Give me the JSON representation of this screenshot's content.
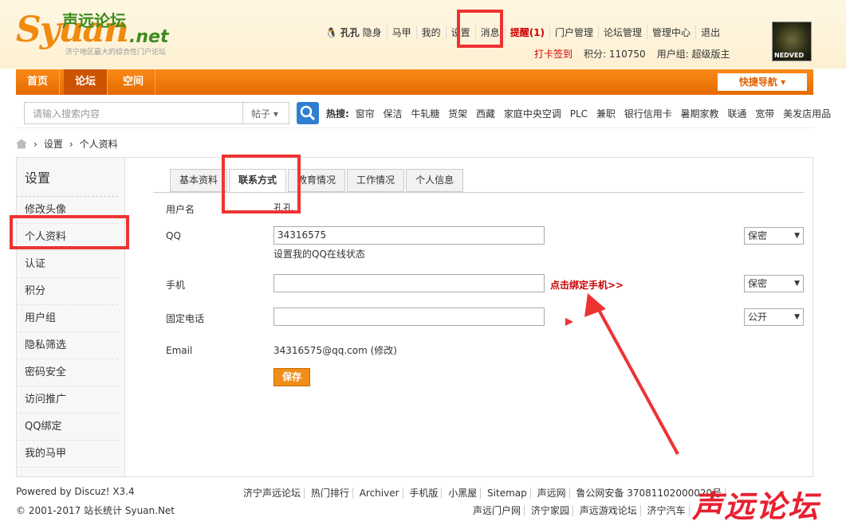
{
  "logo": {
    "brand": "Syuan",
    "net": ".net",
    "cn": "声远论坛",
    "sub": "济宁地区最大的综合性门户论坛"
  },
  "user_menu": {
    "username": "孔孔",
    "status": "隐身",
    "majia": "马甲",
    "mine": "我的",
    "settings": "设置",
    "messages": "消息",
    "reminder": "提醒(1)",
    "portal": "门户管理",
    "forum": "论坛管理",
    "admin": "管理中心",
    "logout": "退出"
  },
  "user_row2": {
    "checkin": "打卡签到",
    "points": "积分: 110750",
    "group": "用户组: 超级版主"
  },
  "avatar_text": "NEDVED",
  "nav": {
    "tabs": [
      "首页",
      "论坛",
      "空间"
    ],
    "quicknav": "快捷导航"
  },
  "search": {
    "placeholder": "请输入搜索内容",
    "type": "帖子",
    "hot_label": "热搜:",
    "hot": [
      "窗帘",
      "保洁",
      "牛轧糖",
      "货架",
      "西藏",
      "家庭中央空调",
      "PLC",
      "兼职",
      "银行信用卡",
      "暑期家教",
      "联通",
      "宽带",
      "美发店用品"
    ]
  },
  "breadcrumb": [
    "设置",
    "个人资料"
  ],
  "sidebar": {
    "title": "设置",
    "items": [
      "修改头像",
      "个人资料",
      "认证",
      "积分",
      "用户组",
      "隐私筛选",
      "密码安全",
      "访问推广",
      "QQ绑定",
      "我的马甲"
    ]
  },
  "tabs": [
    "基本资料",
    "联系方式",
    "教育情况",
    "工作情况",
    "个人信息"
  ],
  "form": {
    "username_label": "用户名",
    "username_value": "孔孔",
    "qq_label": "QQ",
    "qq_value": "34316575",
    "qq_note": "设置我的QQ在线状态",
    "qq_priv": "保密",
    "phone_label": "手机",
    "phone_value": "",
    "phone_bind": "点击绑定手机>>",
    "phone_priv": "保密",
    "tel_label": "固定电话",
    "tel_value": "",
    "tel_priv": "公开",
    "email_label": "Email",
    "email_value": "34316575@qq.com (修改)",
    "save": "保存"
  },
  "footer": {
    "powered": "Powered by Discuz! X3.4",
    "copyright": "© 2001-2017 站长统计 Syuan.Net",
    "links1": [
      "济宁声远论坛",
      "热门排行",
      "Archiver",
      "手机版",
      "小黑屋",
      "Sitemap",
      "声远网",
      "鲁公网安备 37081102000020号"
    ],
    "links2": [
      "声远门户网",
      "济宁家园",
      "声远游戏论坛",
      "济宁汽车"
    ]
  },
  "watermark": "声远论坛"
}
